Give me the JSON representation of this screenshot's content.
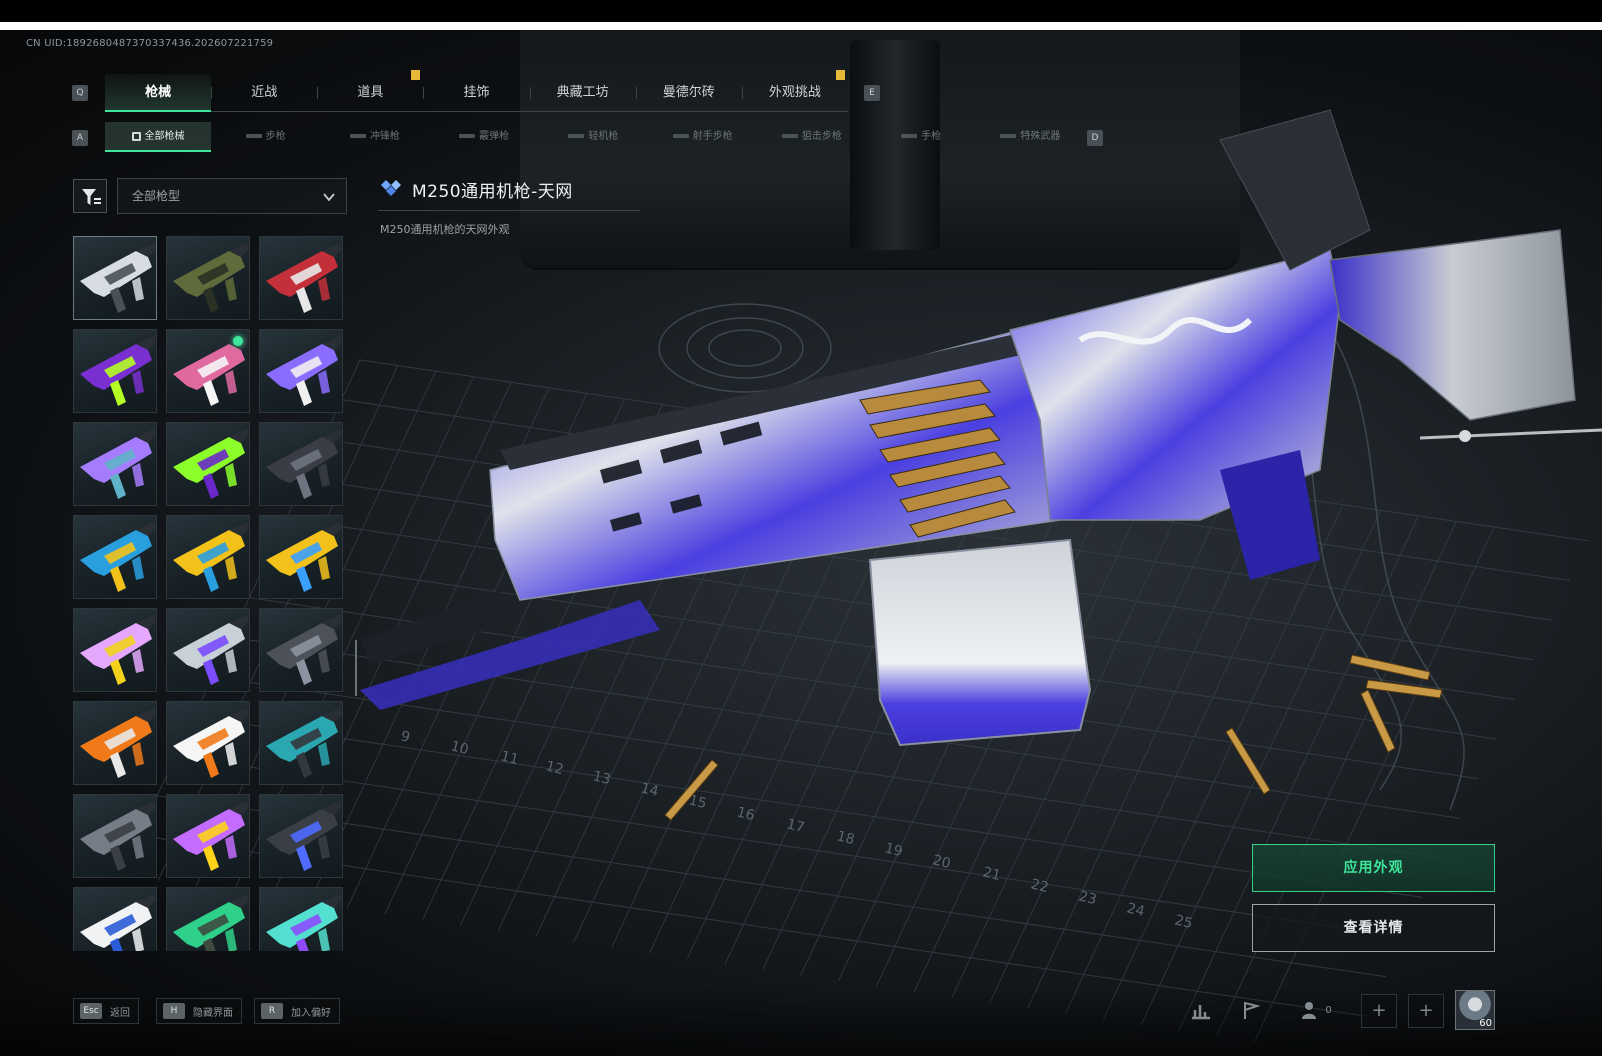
{
  "uid": "CN UID:1892680487370337436.202607221759",
  "keys": {
    "prev_tab": "Q",
    "next_tab": "E",
    "prev_sub": "A",
    "next_sub": "D"
  },
  "main_tabs": [
    "枪械",
    "近战",
    "道具",
    "挂饰",
    "典藏工坊",
    "曼德尔砖",
    "外观挑战"
  ],
  "sub_tabs": [
    "全部枪械",
    "步枪",
    "冲锋枪",
    "霰弹枪",
    "轻机枪",
    "射手步枪",
    "狙击步枪",
    "手枪",
    "特殊武器"
  ],
  "filter": {
    "selected": "全部枪型"
  },
  "selected_skin": {
    "title": "M250通用机枪-天网",
    "description": "M250通用机枪的天网外观"
  },
  "buttons": {
    "apply": "应用外观",
    "details": "查看详情"
  },
  "footer": [
    {
      "key": "Esc",
      "label": "返回"
    },
    {
      "key": "H",
      "label": "隐藏界面"
    },
    {
      "key": "R",
      "label": "加入偏好"
    }
  ],
  "footer_right": {
    "friends_count": "0",
    "level": "60"
  },
  "colors": {
    "accent": "#3fe79c",
    "badge": "#e7b93b",
    "skin_primary": "#4a3fe0"
  },
  "grid_skins": [
    {
      "c1": "#d8dde3",
      "c2": "#4a5058",
      "new": false
    },
    {
      "c1": "#5f6b3a",
      "c2": "#2b3124",
      "new": false
    },
    {
      "c1": "#c3303a",
      "c2": "#e8e8e8",
      "new": false
    },
    {
      "c1": "#7a2fd0",
      "c2": "#b4ff24",
      "new": false
    },
    {
      "c1": "#e06aa0",
      "c2": "#f5f5f5",
      "new": true
    },
    {
      "c1": "#8a6cff",
      "c2": "#f0f0f0",
      "new": false
    },
    {
      "c1": "#a67cff",
      "c2": "#5fb3c9",
      "new": false
    },
    {
      "c1": "#8cff2a",
      "c2": "#6a28c8",
      "new": false
    },
    {
      "c1": "#3a3d45",
      "c2": "#6e7380",
      "new": false
    },
    {
      "c1": "#2a9fe0",
      "c2": "#f2c21b",
      "new": false
    },
    {
      "c1": "#f2c21b",
      "c2": "#2a9fe0",
      "new": false
    },
    {
      "c1": "#f2c21b",
      "c2": "#3aa0ff",
      "new": false
    },
    {
      "c1": "#e6a8ff",
      "c2": "#f2d21b",
      "new": false
    },
    {
      "c1": "#c8d0d8",
      "c2": "#7a4dff",
      "new": false
    },
    {
      "c1": "#4d525a",
      "c2": "#8d93a0",
      "new": false
    },
    {
      "c1": "#f07a1a",
      "c2": "#e8e8e8",
      "new": false
    },
    {
      "c1": "#f5f5f5",
      "c2": "#f07a1a",
      "new": false
    },
    {
      "c1": "#2aa7b0",
      "c2": "#33383e",
      "new": false
    },
    {
      "c1": "#777d86",
      "c2": "#3a3f46",
      "new": false
    },
    {
      "c1": "#c36cff",
      "c2": "#ffd21a",
      "new": false
    },
    {
      "c1": "#3a3f46",
      "c2": "#4f6cff",
      "new": false
    },
    {
      "c1": "#f0f2f4",
      "c2": "#2b5cd8",
      "new": false
    },
    {
      "c1": "#2fd18a",
      "c2": "#3e4a40",
      "new": false
    },
    {
      "c1": "#53e0d0",
      "c2": "#8d4bff",
      "new": false
    }
  ]
}
